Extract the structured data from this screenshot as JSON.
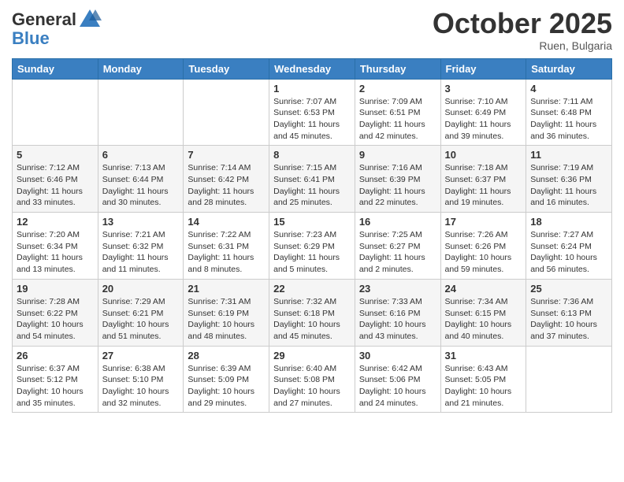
{
  "header": {
    "logo_line1": "General",
    "logo_line2": "Blue",
    "month": "October 2025",
    "location": "Ruen, Bulgaria"
  },
  "days_of_week": [
    "Sunday",
    "Monday",
    "Tuesday",
    "Wednesday",
    "Thursday",
    "Friday",
    "Saturday"
  ],
  "weeks": [
    [
      {
        "day": "",
        "info": ""
      },
      {
        "day": "",
        "info": ""
      },
      {
        "day": "",
        "info": ""
      },
      {
        "day": "1",
        "info": "Sunrise: 7:07 AM\nSunset: 6:53 PM\nDaylight: 11 hours and 45 minutes."
      },
      {
        "day": "2",
        "info": "Sunrise: 7:09 AM\nSunset: 6:51 PM\nDaylight: 11 hours and 42 minutes."
      },
      {
        "day": "3",
        "info": "Sunrise: 7:10 AM\nSunset: 6:49 PM\nDaylight: 11 hours and 39 minutes."
      },
      {
        "day": "4",
        "info": "Sunrise: 7:11 AM\nSunset: 6:48 PM\nDaylight: 11 hours and 36 minutes."
      }
    ],
    [
      {
        "day": "5",
        "info": "Sunrise: 7:12 AM\nSunset: 6:46 PM\nDaylight: 11 hours and 33 minutes."
      },
      {
        "day": "6",
        "info": "Sunrise: 7:13 AM\nSunset: 6:44 PM\nDaylight: 11 hours and 30 minutes."
      },
      {
        "day": "7",
        "info": "Sunrise: 7:14 AM\nSunset: 6:42 PM\nDaylight: 11 hours and 28 minutes."
      },
      {
        "day": "8",
        "info": "Sunrise: 7:15 AM\nSunset: 6:41 PM\nDaylight: 11 hours and 25 minutes."
      },
      {
        "day": "9",
        "info": "Sunrise: 7:16 AM\nSunset: 6:39 PM\nDaylight: 11 hours and 22 minutes."
      },
      {
        "day": "10",
        "info": "Sunrise: 7:18 AM\nSunset: 6:37 PM\nDaylight: 11 hours and 19 minutes."
      },
      {
        "day": "11",
        "info": "Sunrise: 7:19 AM\nSunset: 6:36 PM\nDaylight: 11 hours and 16 minutes."
      }
    ],
    [
      {
        "day": "12",
        "info": "Sunrise: 7:20 AM\nSunset: 6:34 PM\nDaylight: 11 hours and 13 minutes."
      },
      {
        "day": "13",
        "info": "Sunrise: 7:21 AM\nSunset: 6:32 PM\nDaylight: 11 hours and 11 minutes."
      },
      {
        "day": "14",
        "info": "Sunrise: 7:22 AM\nSunset: 6:31 PM\nDaylight: 11 hours and 8 minutes."
      },
      {
        "day": "15",
        "info": "Sunrise: 7:23 AM\nSunset: 6:29 PM\nDaylight: 11 hours and 5 minutes."
      },
      {
        "day": "16",
        "info": "Sunrise: 7:25 AM\nSunset: 6:27 PM\nDaylight: 11 hours and 2 minutes."
      },
      {
        "day": "17",
        "info": "Sunrise: 7:26 AM\nSunset: 6:26 PM\nDaylight: 10 hours and 59 minutes."
      },
      {
        "day": "18",
        "info": "Sunrise: 7:27 AM\nSunset: 6:24 PM\nDaylight: 10 hours and 56 minutes."
      }
    ],
    [
      {
        "day": "19",
        "info": "Sunrise: 7:28 AM\nSunset: 6:22 PM\nDaylight: 10 hours and 54 minutes."
      },
      {
        "day": "20",
        "info": "Sunrise: 7:29 AM\nSunset: 6:21 PM\nDaylight: 10 hours and 51 minutes."
      },
      {
        "day": "21",
        "info": "Sunrise: 7:31 AM\nSunset: 6:19 PM\nDaylight: 10 hours and 48 minutes."
      },
      {
        "day": "22",
        "info": "Sunrise: 7:32 AM\nSunset: 6:18 PM\nDaylight: 10 hours and 45 minutes."
      },
      {
        "day": "23",
        "info": "Sunrise: 7:33 AM\nSunset: 6:16 PM\nDaylight: 10 hours and 43 minutes."
      },
      {
        "day": "24",
        "info": "Sunrise: 7:34 AM\nSunset: 6:15 PM\nDaylight: 10 hours and 40 minutes."
      },
      {
        "day": "25",
        "info": "Sunrise: 7:36 AM\nSunset: 6:13 PM\nDaylight: 10 hours and 37 minutes."
      }
    ],
    [
      {
        "day": "26",
        "info": "Sunrise: 6:37 AM\nSunset: 5:12 PM\nDaylight: 10 hours and 35 minutes."
      },
      {
        "day": "27",
        "info": "Sunrise: 6:38 AM\nSunset: 5:10 PM\nDaylight: 10 hours and 32 minutes."
      },
      {
        "day": "28",
        "info": "Sunrise: 6:39 AM\nSunset: 5:09 PM\nDaylight: 10 hours and 29 minutes."
      },
      {
        "day": "29",
        "info": "Sunrise: 6:40 AM\nSunset: 5:08 PM\nDaylight: 10 hours and 27 minutes."
      },
      {
        "day": "30",
        "info": "Sunrise: 6:42 AM\nSunset: 5:06 PM\nDaylight: 10 hours and 24 minutes."
      },
      {
        "day": "31",
        "info": "Sunrise: 6:43 AM\nSunset: 5:05 PM\nDaylight: 10 hours and 21 minutes."
      },
      {
        "day": "",
        "info": ""
      }
    ]
  ]
}
